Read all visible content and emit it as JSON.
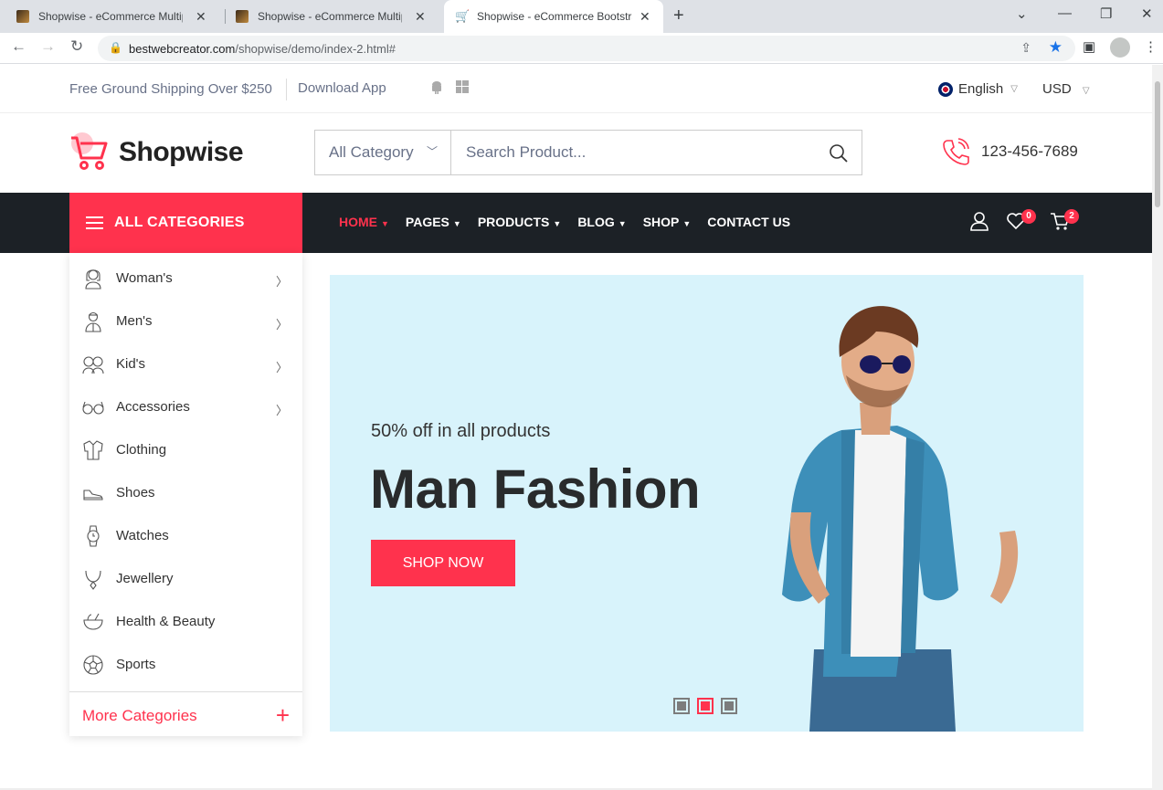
{
  "browser": {
    "tabs": [
      {
        "title": "Shopwise - eCommerce Multipur"
      },
      {
        "title": "Shopwise - eCommerce Multipur"
      },
      {
        "title": "Shopwise - eCommerce Bootstra"
      }
    ],
    "url_host": "bestwebcreator.com",
    "url_path": "/shopwise/demo/index-2.html#"
  },
  "topbar": {
    "shipping_text": "Free Ground Shipping Over $250",
    "download_text": "Download App",
    "language": "English",
    "currency": "USD"
  },
  "header": {
    "logo_text": "Shopwise",
    "category_select": "All Category",
    "search_placeholder": "Search Product...",
    "phone": "123-456-7689"
  },
  "nav": {
    "all_categories_label": "ALL CATEGORIES",
    "menu": [
      {
        "label": "HOME"
      },
      {
        "label": "PAGES"
      },
      {
        "label": "PRODUCTS"
      },
      {
        "label": "BLOG"
      },
      {
        "label": "SHOP"
      },
      {
        "label": "CONTACT US"
      }
    ],
    "wishlist_count": "0",
    "cart_count": "2"
  },
  "categories": {
    "items": [
      {
        "label": "Woman's",
        "icon": "woman-icon"
      },
      {
        "label": "Men's",
        "icon": "man-icon"
      },
      {
        "label": "Kid's",
        "icon": "kids-icon"
      },
      {
        "label": "Accessories",
        "icon": "glasses-icon"
      },
      {
        "label": "Clothing",
        "icon": "shirt-icon"
      },
      {
        "label": "Shoes",
        "icon": "shoe-icon"
      },
      {
        "label": "Watches",
        "icon": "watch-icon"
      },
      {
        "label": "Jewellery",
        "icon": "necklace-icon"
      },
      {
        "label": "Health & Beauty",
        "icon": "beauty-bowl-icon"
      },
      {
        "label": "Sports",
        "icon": "football-icon"
      }
    ],
    "more_label": "More Categories"
  },
  "hero": {
    "subtitle": "50% off in all products",
    "headline": "Man Fashion",
    "button_label": "SHOP NOW",
    "slide_count": 3,
    "active_slide": 2
  },
  "colors": {
    "accent": "#ff324d",
    "navbar": "#1c2126",
    "hero_bg": "#d8f3fb"
  }
}
